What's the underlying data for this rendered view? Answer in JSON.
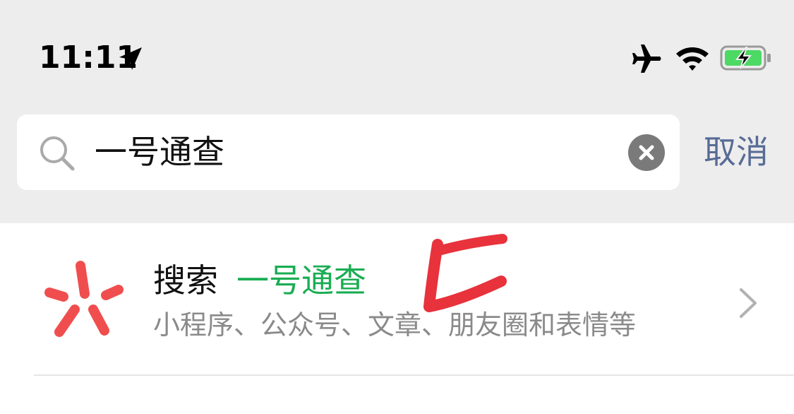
{
  "status_bar": {
    "time": "11:11",
    "icons": [
      "location-arrow-icon",
      "airplane-icon",
      "wifi-icon",
      "battery-charging-icon"
    ]
  },
  "search": {
    "value": "一号通查",
    "placeholder": "",
    "icon": "search-icon",
    "clear_icon": "clear-icon",
    "cancel_label": "取消"
  },
  "result": {
    "icon": "wechat-search-icon",
    "title_prefix": "搜索",
    "title_query": "一号通查",
    "subtitle": "小程序、公众号、文章、朋友圈和表情等",
    "chevron_icon": "chevron-right-icon"
  },
  "colors": {
    "top_background": "#ededed",
    "link_blue": "#576b95",
    "query_green": "#1aad53",
    "icon_red": "#f04e4e",
    "annotation_red": "#e8323c",
    "battery_green": "#4cd964"
  }
}
